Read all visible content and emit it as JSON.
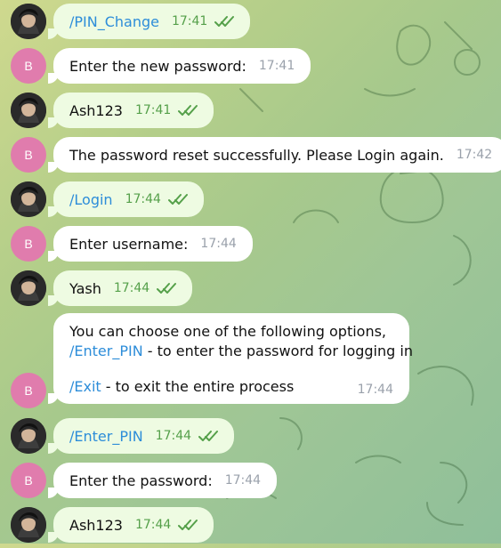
{
  "messages": [
    {
      "sender": "user",
      "text": "/PIN_Change",
      "is_command": true,
      "time": "17:41",
      "status_icon": "double-check-icon"
    },
    {
      "sender": "bot",
      "avatar_letter": "B",
      "text": "Enter the new password:",
      "time": "17:41"
    },
    {
      "sender": "user",
      "text": "Ash123",
      "time": "17:41",
      "status_icon": "double-check-icon"
    },
    {
      "sender": "bot",
      "avatar_letter": "B",
      "text": "The password reset successfully. Please Login again.",
      "time": "17:42"
    },
    {
      "sender": "user",
      "text": "/Login",
      "is_command": true,
      "time": "17:44",
      "status_icon": "double-check-icon"
    },
    {
      "sender": "bot",
      "avatar_letter": "B",
      "text": "Enter username:",
      "time": "17:44"
    },
    {
      "sender": "user",
      "text": "Yash",
      "time": "17:44",
      "status_icon": "double-check-icon"
    },
    {
      "sender": "bot",
      "avatar_letter": "B",
      "lines": [
        {
          "text": "You can choose one of the following options,"
        },
        {
          "command": "/Enter_PIN",
          "text": " - to enter the password for logging in"
        },
        {
          "spacer": true
        },
        {
          "command": "/Exit",
          "text": " - to exit the entire process"
        }
      ],
      "time": "17:44"
    },
    {
      "sender": "user",
      "text": "/Enter_PIN",
      "is_command": true,
      "time": "17:44",
      "status_icon": "double-check-icon"
    },
    {
      "sender": "bot",
      "avatar_letter": "B",
      "text": "Enter the password:",
      "time": "17:44"
    },
    {
      "sender": "user",
      "text": "Ash123",
      "time": "17:44",
      "status_icon": "double-check-icon"
    }
  ],
  "colors": {
    "user_bubble": "#eefbe2",
    "bot_bubble": "#ffffff",
    "command_link": "#2d8dd9",
    "bot_avatar": "#e07cad",
    "user_time": "#55a04a",
    "bot_time": "#9aa1ab"
  }
}
